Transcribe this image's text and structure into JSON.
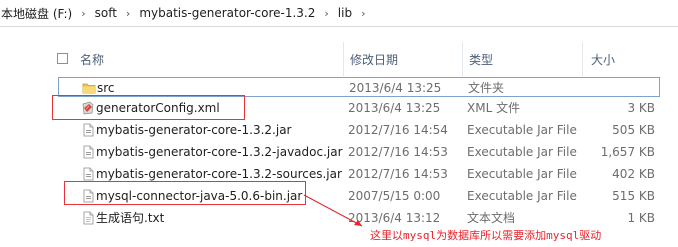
{
  "breadcrumb": {
    "items": [
      "本地磁盘 (F:)",
      "soft",
      "mybatis-generator-core-1.3.2",
      "lib"
    ],
    "separator": "›"
  },
  "columns": {
    "name": "名称",
    "date": "修改日期",
    "type": "类型",
    "size": "大小"
  },
  "files": [
    {
      "name": "src",
      "date": "2013/6/4 13:25",
      "type": "文件夹",
      "size": "",
      "icon": "folder-icon",
      "selected": true
    },
    {
      "name": "generatorConfig.xml",
      "date": "2013/6/4 13:25",
      "type": "XML 文件",
      "size": "3 KB",
      "icon": "xml-file-icon",
      "selected": false
    },
    {
      "name": "mybatis-generator-core-1.3.2.jar",
      "date": "2012/7/16 14:54",
      "type": "Executable Jar File",
      "size": "505 KB",
      "icon": "jar-file-icon",
      "selected": false
    },
    {
      "name": "mybatis-generator-core-1.3.2-javadoc.jar",
      "date": "2012/7/16 14:53",
      "type": "Executable Jar File",
      "size": "1,657 KB",
      "icon": "jar-file-icon",
      "selected": false
    },
    {
      "name": "mybatis-generator-core-1.3.2-sources.jar",
      "date": "2012/7/16 14:53",
      "type": "Executable Jar File",
      "size": "402 KB",
      "icon": "jar-file-icon",
      "selected": false
    },
    {
      "name": "mysql-connector-java-5.0.6-bin.jar",
      "date": "2007/5/15 0:00",
      "type": "Executable Jar File",
      "size": "515 KB",
      "icon": "jar-file-icon",
      "selected": false
    },
    {
      "name": "生成语句.txt",
      "date": "2013/6/4 13:12",
      "type": "文本文档",
      "size": "1 KB",
      "icon": "text-file-icon",
      "selected": false
    }
  ],
  "annotation": {
    "text": "这里以mysql为数据库所以需要添加mysql驱动",
    "color": "#e8232a"
  },
  "colors": {
    "highlight_box": "#e8333a",
    "selection_border": "#7da2ce",
    "header_text": "#4c607a"
  }
}
